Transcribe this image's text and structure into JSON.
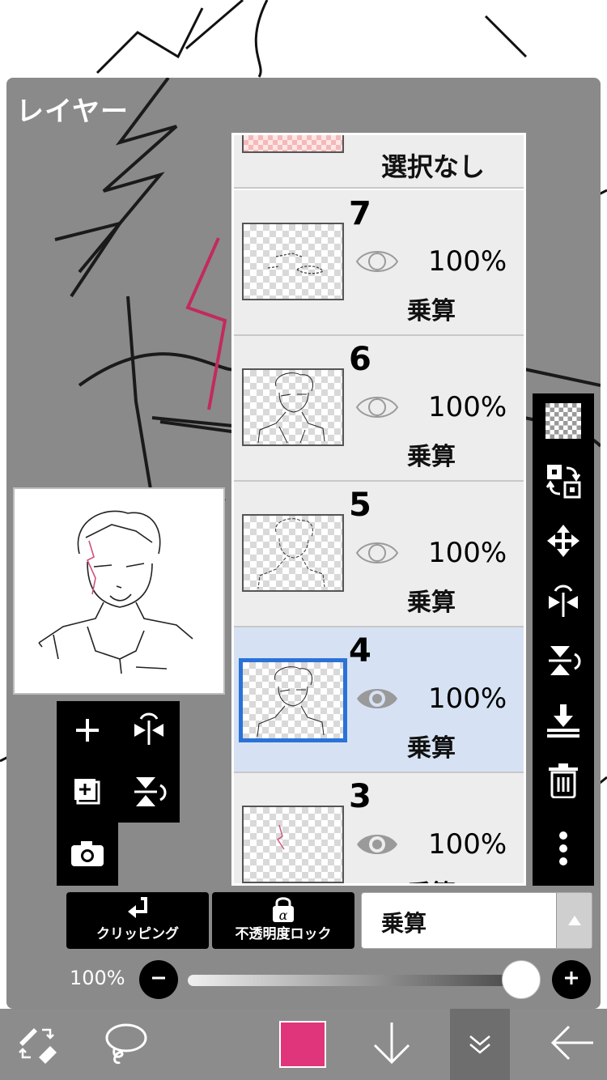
{
  "panel": {
    "title": "レイヤー"
  },
  "layers": {
    "no_selection_label": "選択なし",
    "items": [
      {
        "number": "7",
        "opacity": "100%",
        "blend": "乗算",
        "selected": false
      },
      {
        "number": "6",
        "opacity": "100%",
        "blend": "乗算",
        "selected": false
      },
      {
        "number": "5",
        "opacity": "100%",
        "blend": "乗算",
        "selected": false
      },
      {
        "number": "4",
        "opacity": "100%",
        "blend": "乗算",
        "selected": true
      },
      {
        "number": "3",
        "opacity": "100%",
        "blend": "乗算",
        "selected": false
      }
    ]
  },
  "controls": {
    "clipping_label": "クリッピング",
    "alpha_lock_label": "不透明度ロック",
    "blend_mode_value": "乗算",
    "opacity_label": "100%",
    "opacity_value": 1.0
  },
  "right_toolbar": {
    "icons": [
      "transparency-icon",
      "swap-layer-icon",
      "move-icon",
      "flip-horizontal-icon",
      "flip-vertical-icon",
      "merge-down-icon",
      "trash-icon",
      "more-icon"
    ]
  },
  "left_tools": {
    "icons": [
      "add-layer-icon",
      "flip-horizontal-icon",
      "add-layer-copy-icon",
      "flip-vertical-icon",
      "camera-icon"
    ]
  },
  "bottom_bar": {
    "current_color": "#e0357a",
    "icons": [
      "brush-eraser-icon",
      "lasso-icon",
      "color-swatch",
      "arrow-down-icon",
      "chevron-down-icon",
      "back-arrow-icon"
    ]
  },
  "colors": {
    "panel_bg": "#8a8a8a",
    "selected_row": "#d6e2f4",
    "selected_border": "#2a72d8",
    "accent_pink": "#e0357a"
  }
}
